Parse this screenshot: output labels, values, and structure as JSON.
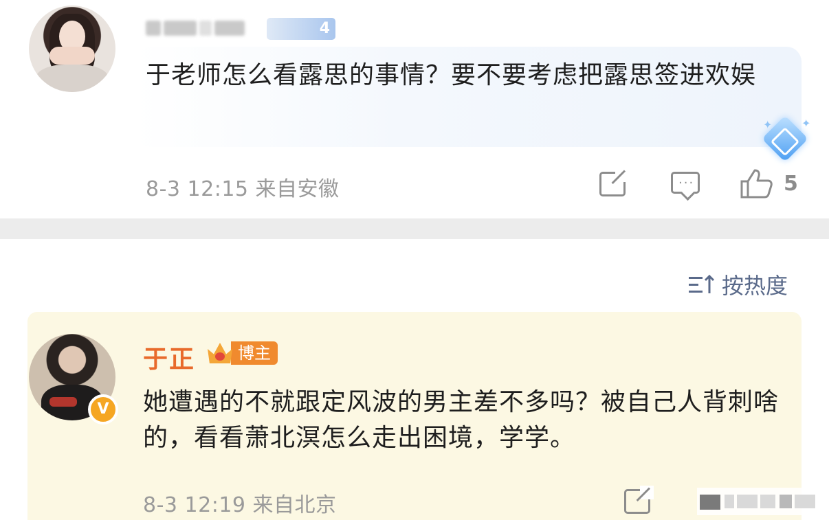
{
  "top_comment": {
    "level": "4",
    "text": "于老师怎么看露思的事情？要不要考虑把露思签进欢娱",
    "meta": "8-3 12:15 来自安徽",
    "like_count": "5",
    "icons": [
      "share-icon",
      "comment-icon",
      "like-icon"
    ]
  },
  "sort": {
    "label": "按热度"
  },
  "reply": {
    "author": "于正",
    "author_badge": "博主",
    "verified_mark": "V",
    "text": "她遭遇的不就跟定风波的男主差不多吗？被自己人背刺啥的，看看萧北溟怎么走出困境，学学。",
    "meta": "8-3 12:19 来自北京"
  },
  "colors": {
    "author_name": "#e86a2b",
    "reply_background": "#fcf8e3",
    "sort_text": "#5a6a8a",
    "meta_text": "#9a9a9a"
  }
}
